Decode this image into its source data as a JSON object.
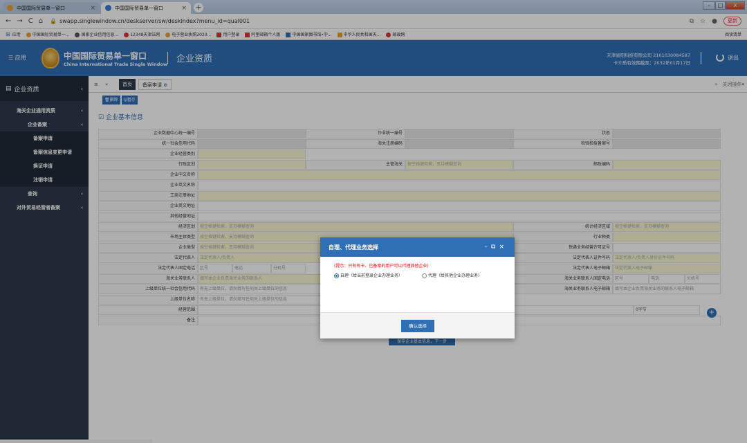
{
  "browser": {
    "tabs": [
      {
        "title": "中国国际贸易单一窗口"
      },
      {
        "title": "中国国际贸易单一窗口"
      }
    ],
    "url": "swapp.singlewindow.cn/deskserver/sw/deskIndex?menu_id=qual001",
    "update_label": "更新",
    "bookmarks": [
      "应用",
      "中国国际贸易单一...",
      "国家企业信用信息...",
      "12348天津法网",
      "电子营业执照2020...",
      "用户登录",
      "阿里邮箱个人版",
      "中国国家图书馆•中...",
      "中华人民共和国天...",
      "邮政网"
    ],
    "reading_list": "阅读清单"
  },
  "header": {
    "menu": "应用",
    "brand_cn": "中国国际贸易单一窗口",
    "brand_en": "China International Trade Single Window",
    "module": "企业资质",
    "company": "天津省阳科技有限公司 2101030084587",
    "card_valid": "卡介质有效期截至：2032年01月17日",
    "logout": "退出"
  },
  "sidebar": {
    "title": "企业资质",
    "items": [
      {
        "label": "海关企业通用资质",
        "level": 1
      },
      {
        "label": "企业备案",
        "level": 2
      },
      {
        "label": "备案申请",
        "level": 3
      },
      {
        "label": "备案信息变更申请",
        "level": 3
      },
      {
        "label": "换证申请",
        "level": 3
      },
      {
        "label": "注销申请",
        "level": 3
      },
      {
        "label": "查询",
        "level": 2
      },
      {
        "label": "对外贸易经营者备案",
        "level": 1
      }
    ]
  },
  "tabs": {
    "home": "首页",
    "current": "备案申请",
    "close_ops": "关闭操作"
  },
  "toolbar": {
    "delete": "删除",
    "save": "暂存"
  },
  "section_title": "企业基本信息",
  "form": {
    "r1": [
      "企业数据中心统一编号",
      "作业统一编号",
      "状态"
    ],
    "r2": [
      "统一社会信用代码",
      "海关注册编码",
      "检验检疫备案号"
    ],
    "r3": [
      "企业经营类别"
    ],
    "r4": [
      "行政区划",
      "主管海关",
      "邮政编码"
    ],
    "r5": [
      "企业中文名称"
    ],
    "r6": [
      "企业英文名称"
    ],
    "r7": [
      "工商注册地址"
    ],
    "r8": [
      "企业英文地址"
    ],
    "r9": [
      "其他经营地址"
    ],
    "r10": [
      "经济区划",
      "统计经济区域"
    ],
    "r11": [
      "市场主体类型",
      "行业种类"
    ],
    "r12": [
      "企业类型",
      "快递业务经营许可证号"
    ],
    "r13": [
      "法定代表人",
      "法定代表人证件号码"
    ],
    "r14": [
      "法定代表人固定电话",
      "法定代表人电子邮箱"
    ],
    "r15": [
      "海关业务联系人",
      "海关业务联系人固定电话"
    ],
    "r16": [
      "上级单位统一社会信用代码",
      "海关业务联系人电子邮箱"
    ],
    "r17": [
      "上级单位名称"
    ],
    "r18": [
      "经营范围"
    ],
    "r19": [
      "备注"
    ],
    "ph_search": "按空格键检索，支持模糊查询",
    "ph_legal": "法定代表人/负责人",
    "ph_cert": "法定代表人/负责人身份证件号码",
    "ph_email": "法定代表人电子邮箱",
    "ph_contact": "填写本企业负责海关业务的联系人",
    "ph_contact_email": "填写本企业负责海关业务的联系人电子邮箱",
    "ph_area": "区号",
    "ph_tel": "电话",
    "ph_ext": "分机号",
    "ph_parent_code": "有无上级单位，请勿填写任何关上级单位的信息",
    "ph_parent_name": "有无上级单位，请勿填写任何关上级单位的信息",
    "bytes": "0字节"
  },
  "next_button": "保存企业基本信息，下一步",
  "dialog": {
    "title": "自理、代理业务选择",
    "tip": "(提示：只有有卡、已备案的用户可以代理其他企业)",
    "option1": "自理（给当前登录企业办理业务）",
    "option2": "代理（给其他企业办理业务）",
    "confirm": "确认选择"
  }
}
